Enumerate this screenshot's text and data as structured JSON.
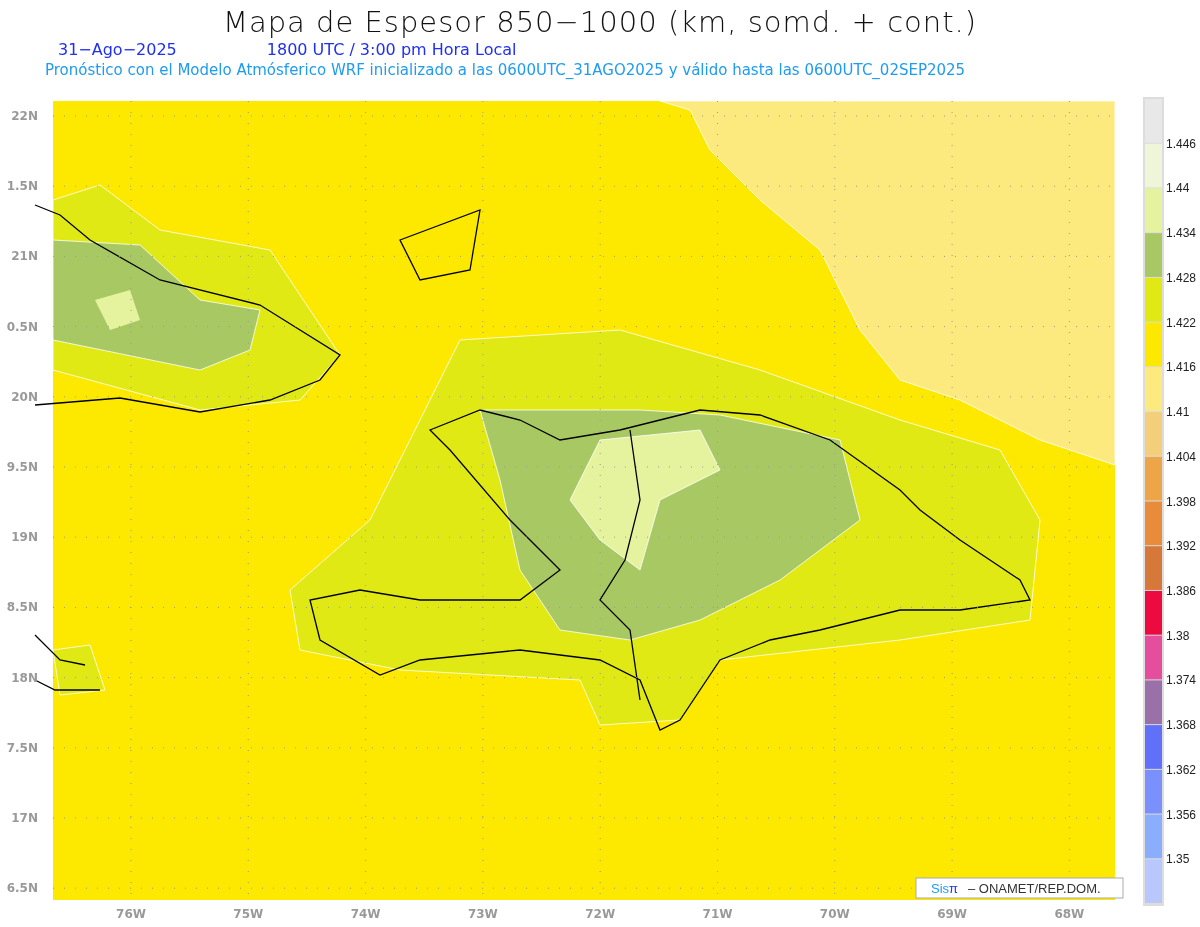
{
  "title": "Mapa de Espesor 850−1000 (km, somd. + cont.)",
  "date": "31−Ago−2025",
  "time_line": "1800 UTC / 3:00 pm Hora Local",
  "subtitle": "Pronóstico con el Modelo Atmósferico WRF inicializado a las 0600UTC_31AGO2025 y válido hasta las  0600UTC_02SEP2025",
  "y_axis": [
    "22N",
    "1.5N",
    "21N",
    "0.5N",
    "20N",
    "9.5N",
    "19N",
    "8.5N",
    "18N",
    "7.5N",
    "17N",
    "6.5N"
  ],
  "x_axis": [
    "76W",
    "75W",
    "74W",
    "73W",
    "72W",
    "71W",
    "70W",
    "69W",
    "68W"
  ],
  "legend": {
    "bins": [
      {
        "color": "#e8e8e8"
      },
      {
        "color": "#eef5d8"
      },
      {
        "color": "#e6f39e"
      },
      {
        "color": "#a8c864"
      },
      {
        "color": "#e0e914"
      },
      {
        "color": "#fde800"
      },
      {
        "color": "#fdea7e"
      },
      {
        "color": "#f3cf7c"
      },
      {
        "color": "#eca648"
      },
      {
        "color": "#e88c3c"
      },
      {
        "color": "#d5783a"
      },
      {
        "color": "#ec0a3e"
      },
      {
        "color": "#e44e9c"
      },
      {
        "color": "#9a70a8"
      },
      {
        "color": "#6070f8"
      },
      {
        "color": "#7a90fc"
      },
      {
        "color": "#8aaefc"
      },
      {
        "color": "#b8c8fc"
      }
    ],
    "labels": [
      "1.446",
      "1.44",
      "1.434",
      "1.428",
      "1.422",
      "1.416",
      "1.41",
      "1.404",
      "1.398",
      "1.392",
      "1.386",
      "1.38",
      "1.374",
      "1.368",
      "1.362",
      "1.356",
      "1.35"
    ]
  },
  "credit": {
    "logo_prefix": "Sis",
    "logo_symbol": "π",
    "text": "– ONAMET/REP.DOM."
  }
}
